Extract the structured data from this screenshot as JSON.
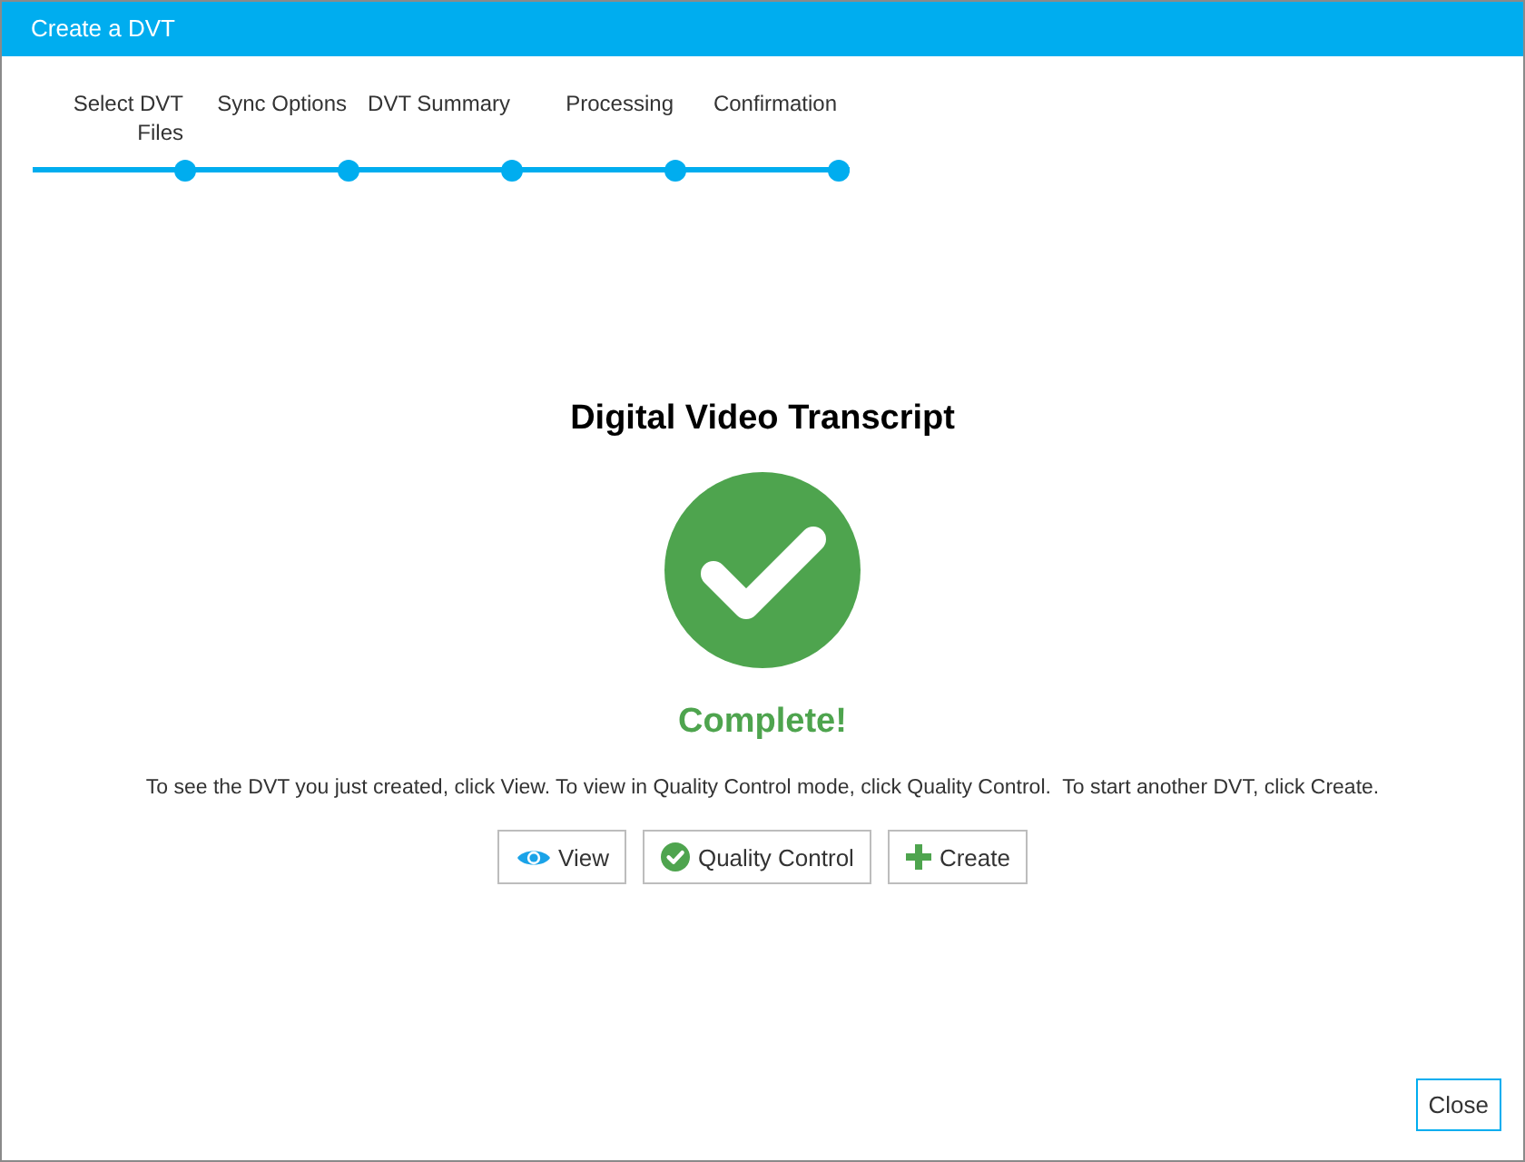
{
  "window": {
    "title": "Create a DVT"
  },
  "steps": [
    {
      "label": "Select DVT Files"
    },
    {
      "label": "Sync Options"
    },
    {
      "label": "DVT Summary"
    },
    {
      "label": "Processing"
    },
    {
      "label": "Confirmation"
    }
  ],
  "result": {
    "heading": "Digital Video Transcript",
    "status": "Complete!",
    "message": "To see the DVT you just created, click View. To view in Quality Control mode, click Quality Control.  To start another DVT, click Create."
  },
  "actions": [
    {
      "kind": "view",
      "label": "View"
    },
    {
      "kind": "quality",
      "label": "Quality Control"
    },
    {
      "kind": "create",
      "label": "Create"
    }
  ],
  "close_button": "Close"
}
